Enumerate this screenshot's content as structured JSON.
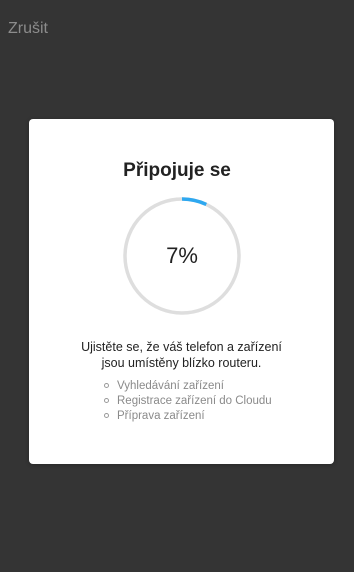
{
  "header": {
    "cancel_label": "Zrušit"
  },
  "dialog": {
    "title": "Připojuje se",
    "progress_value": 7,
    "progress_text": "7%",
    "message_line1": "Ujistěte se, že váš telefon a zařízení",
    "message_line2": "jsou umístěny blízko routeru.",
    "steps": [
      "Vyhledávání zařízení",
      "Registrace zařízení do Cloudu",
      "Příprava zařízení"
    ]
  },
  "colors": {
    "backdrop": "#343434",
    "accent": "#2ea8f0",
    "ring_track": "#dedede"
  }
}
